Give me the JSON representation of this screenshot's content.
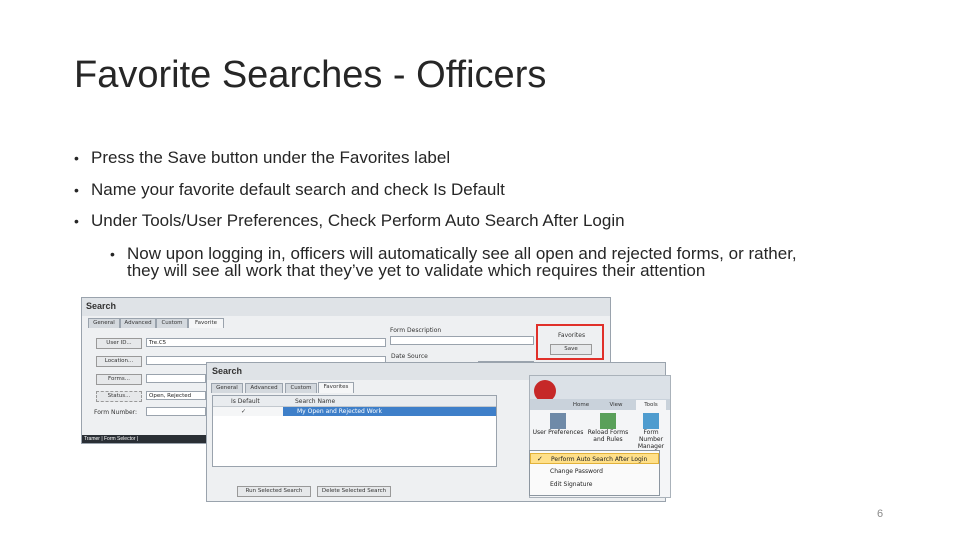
{
  "slide": {
    "title": "Favorite Searches - Officers",
    "page_number": "6",
    "bullets": [
      "Press the Save button under the Favorites label",
      "Name your favorite default search and check Is Default",
      "Under Tools/User Preferences, Check Perform Auto Search After Login"
    ],
    "sub_bullet_line1": "Now upon logging in, officers will automatically see all open and rejected forms, or rather,",
    "sub_bullet_line2": "they will see all work that they’ve yet to validate which requires their attention",
    "bullet_char": "•"
  },
  "search_window": {
    "title": "Search",
    "tabs": [
      "General",
      "Advanced",
      "Custom",
      "Favorite"
    ],
    "buttons": [
      "User ID...",
      "Location...",
      "Forms...",
      "Status..."
    ],
    "user_id_value": "Tre.C5",
    "status_value": "Open, Rejected",
    "form_number_label": "Form Number:",
    "form_description_label": "Form Description",
    "date_source_label": "Date Source",
    "favorites_label": "Favorites",
    "favorites_save": "Save",
    "status_bar": "Tramer | Form Selector |"
  },
  "favorites_window": {
    "title": "Search",
    "tabs": [
      "General",
      "Advanced",
      "Custom",
      "Favorites"
    ],
    "col_is_default": "Is Default",
    "col_search_name": "Search Name",
    "row_search_name": "My Open and Rejected Work",
    "run_button": "Run Selected Search",
    "delete_button": "Delete Selected Search"
  },
  "ribbon": {
    "tabs": [
      "Home",
      "View",
      "Tools"
    ],
    "groups": [
      "User Preferences",
      "Reload Forms and Rules",
      "Form Number Manager"
    ],
    "menu_items": [
      "Perform Auto Search After Login",
      "Change Password",
      "Edit Signature"
    ],
    "checkmark": "✓"
  },
  "colors": {
    "highlight_red": "#e0302a",
    "selection_blue": "#3e7fc9",
    "menu_highlight": "#ffe08a"
  }
}
